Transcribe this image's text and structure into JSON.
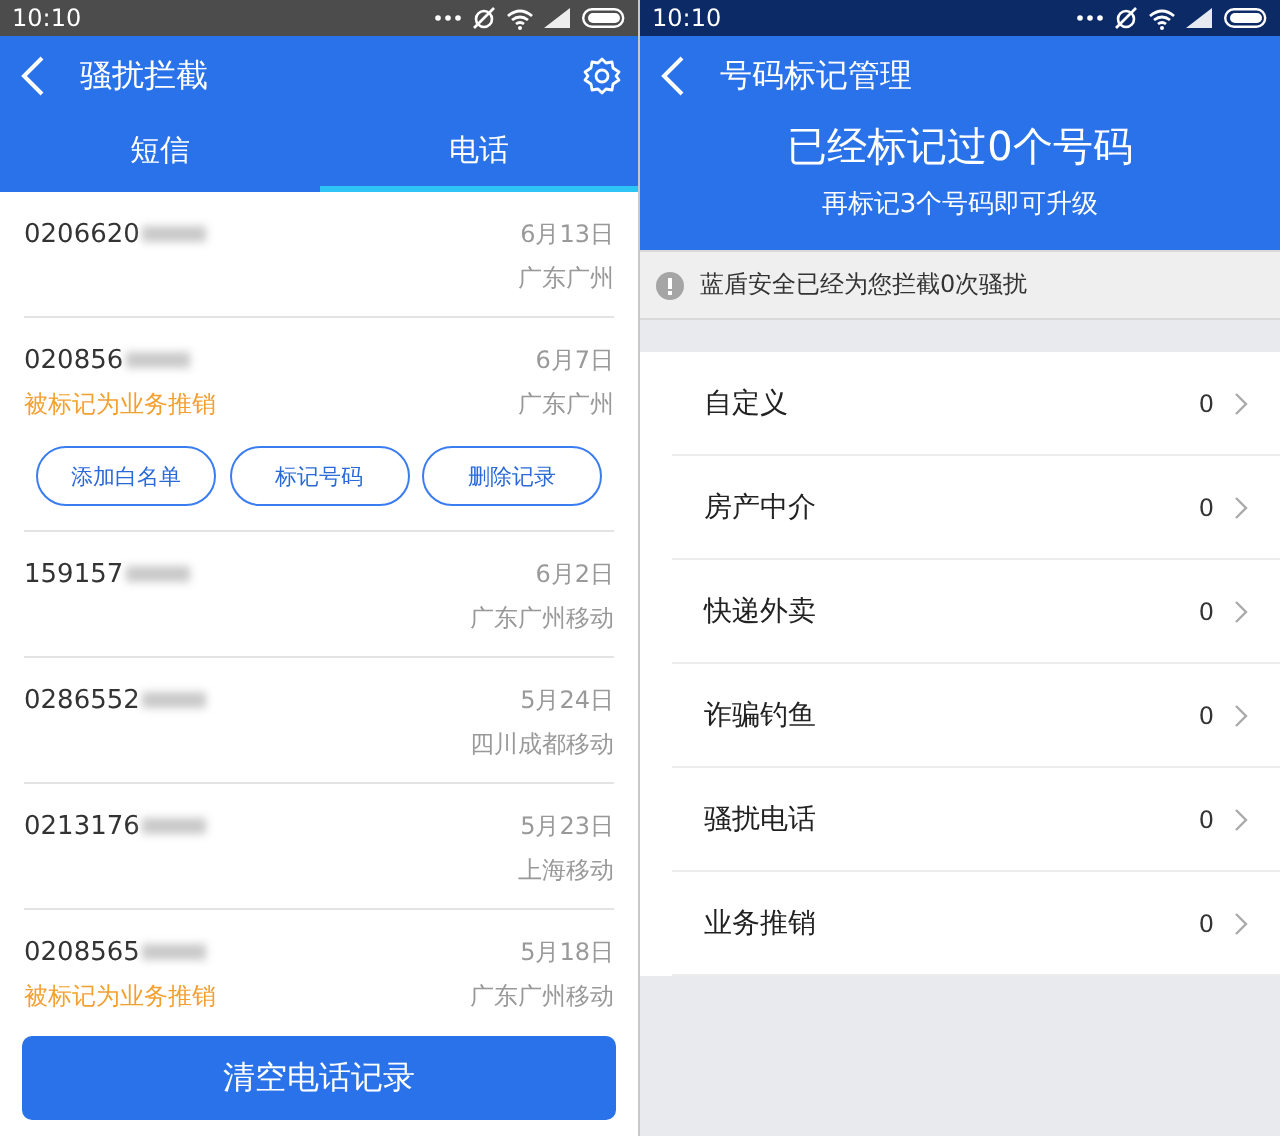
{
  "left": {
    "status_bar": {
      "time": "10:10"
    },
    "title": "骚扰拦截",
    "tabs": [
      {
        "label": "短信",
        "selected": false
      },
      {
        "label": "电话",
        "selected": true
      }
    ],
    "calls": [
      {
        "number": "0206620",
        "date": "6月13日",
        "location": "广东广州"
      },
      {
        "number": "020856",
        "date": "6月7日",
        "tag": "被标记为业务推销",
        "location": "广东广州",
        "actions": [
          "添加白名单",
          "标记号码",
          "删除记录"
        ]
      },
      {
        "number": "159157",
        "date": "6月2日",
        "location": "广东广州移动"
      },
      {
        "number": "0286552",
        "date": "5月24日",
        "location": "四川成都移动"
      },
      {
        "number": "0213176",
        "date": "5月23日",
        "location": "上海移动"
      },
      {
        "number": "0208565",
        "date": "5月18日",
        "tag": "被标记为业务推销",
        "location": "广东广州移动"
      }
    ],
    "clear_button": "清空电话记录"
  },
  "right": {
    "status_bar": {
      "time": "10:10"
    },
    "title": "号码标记管理",
    "headline": "已经标记过0个号码",
    "subline": "再标记3个号码即可升级",
    "notice": "蓝盾安全已经为您拦截0次骚扰",
    "categories": [
      {
        "label": "自定义",
        "count": "0"
      },
      {
        "label": "房产中介",
        "count": "0"
      },
      {
        "label": "快递外卖",
        "count": "0"
      },
      {
        "label": "诈骗钓鱼",
        "count": "0"
      },
      {
        "label": "骚扰电话",
        "count": "0"
      },
      {
        "label": "业务推销",
        "count": "0"
      }
    ]
  }
}
